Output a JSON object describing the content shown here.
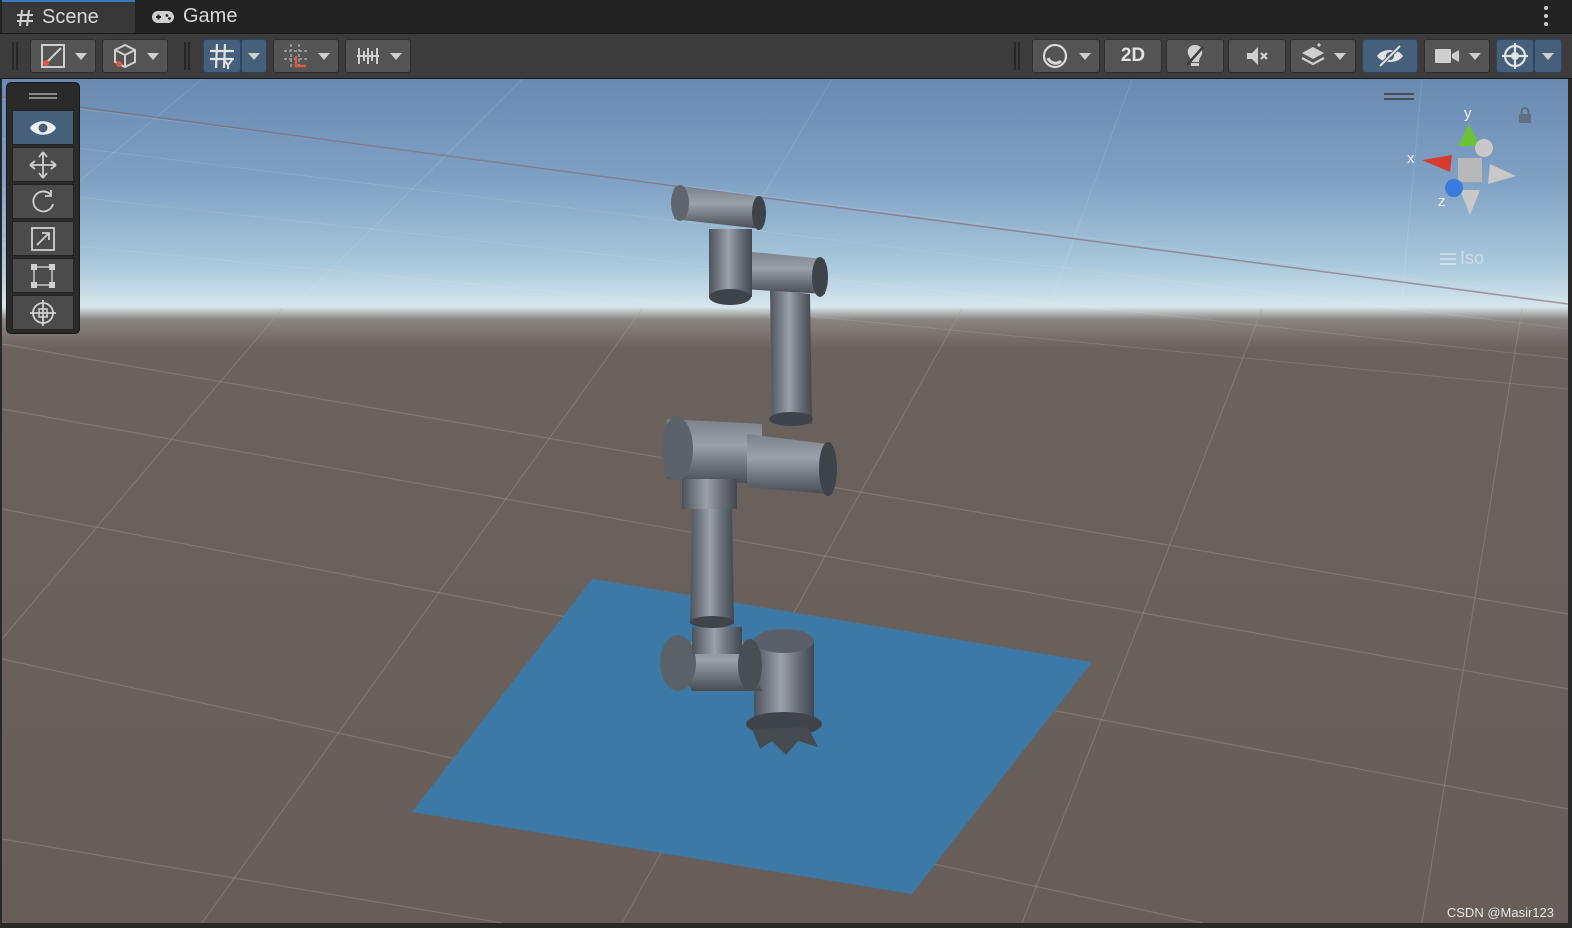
{
  "tabs": [
    {
      "label": "Scene",
      "icon": "hash-grid-icon",
      "active": true
    },
    {
      "label": "Game",
      "icon": "gamepad-icon",
      "active": false
    }
  ],
  "toolbar": {
    "view_2d_label": "2D",
    "accent_color": "#46607c"
  },
  "gizmo": {
    "x_label": "x",
    "y_label": "y",
    "z_label": "z",
    "projection_label": "Iso"
  },
  "tools": [
    {
      "name": "view-tool",
      "icon": "eye-icon",
      "active": true
    },
    {
      "name": "move-tool",
      "icon": "move-arrows-icon",
      "active": false
    },
    {
      "name": "rotate-tool",
      "icon": "rotate-icon",
      "active": false
    },
    {
      "name": "scale-tool",
      "icon": "scale-icon",
      "active": false
    },
    {
      "name": "rect-tool",
      "icon": "rect-transform-icon",
      "active": false
    },
    {
      "name": "transform-tool",
      "icon": "transform-icon",
      "active": false
    }
  ],
  "watermark": "CSDN @Masir123",
  "colors": {
    "ground": "#675e5a",
    "plane": "#3d79a6",
    "robot": "#6e757e",
    "gizmo_x": "#d83a2e",
    "gizmo_y": "#6cc13a",
    "gizmo_z": "#3a7be0"
  }
}
